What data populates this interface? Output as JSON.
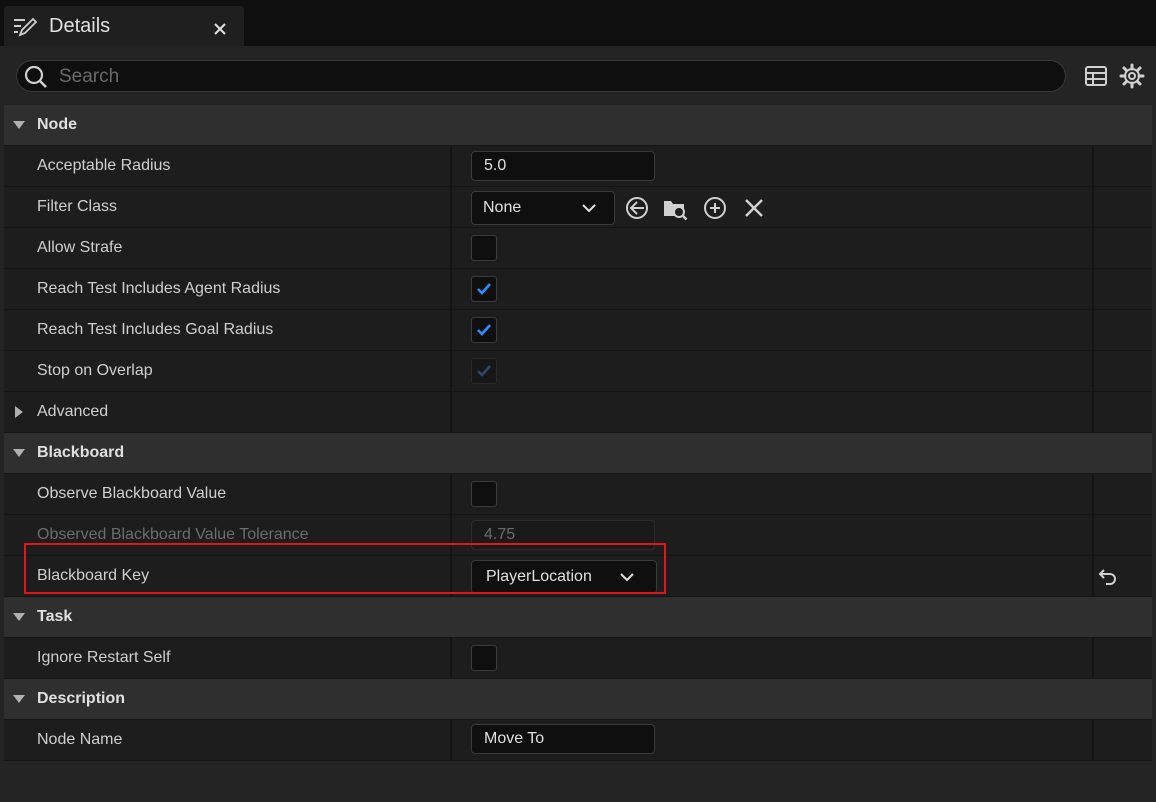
{
  "tab": {
    "title": "Details"
  },
  "search": {
    "placeholder": "Search",
    "value": ""
  },
  "toolbar": {
    "icons": [
      "table-view-icon",
      "settings-gear-icon"
    ]
  },
  "sections": {
    "node": {
      "title": "Node",
      "acceptable_radius": {
        "label": "Acceptable Radius",
        "value": "5.0"
      },
      "filter_class": {
        "label": "Filter Class",
        "value": "None"
      },
      "allow_strafe": {
        "label": "Allow Strafe",
        "checked": false
      },
      "reach_agent": {
        "label": "Reach Test Includes Agent Radius",
        "checked": true
      },
      "reach_goal": {
        "label": "Reach Test Includes Goal Radius",
        "checked": true
      },
      "stop_on_overlap": {
        "label": "Stop on Overlap",
        "checked": true,
        "enabled": false
      }
    },
    "advanced": {
      "title": "Advanced"
    },
    "blackboard": {
      "title": "Blackboard",
      "observe_value": {
        "label": "Observe Blackboard Value",
        "checked": false
      },
      "tolerance": {
        "label": "Observed Blackboard Value Tolerance",
        "value": "4.75",
        "enabled": false
      },
      "key": {
        "label": "Blackboard Key",
        "value": "PlayerLocation"
      }
    },
    "task": {
      "title": "Task",
      "ignore_restart": {
        "label": "Ignore Restart Self",
        "checked": false
      }
    },
    "description": {
      "title": "Description",
      "node_name": {
        "label": "Node Name",
        "value": "Move To"
      }
    }
  },
  "colors": {
    "accent": "#2d8fff",
    "highlight": "#e0171b",
    "background": "#242424"
  }
}
